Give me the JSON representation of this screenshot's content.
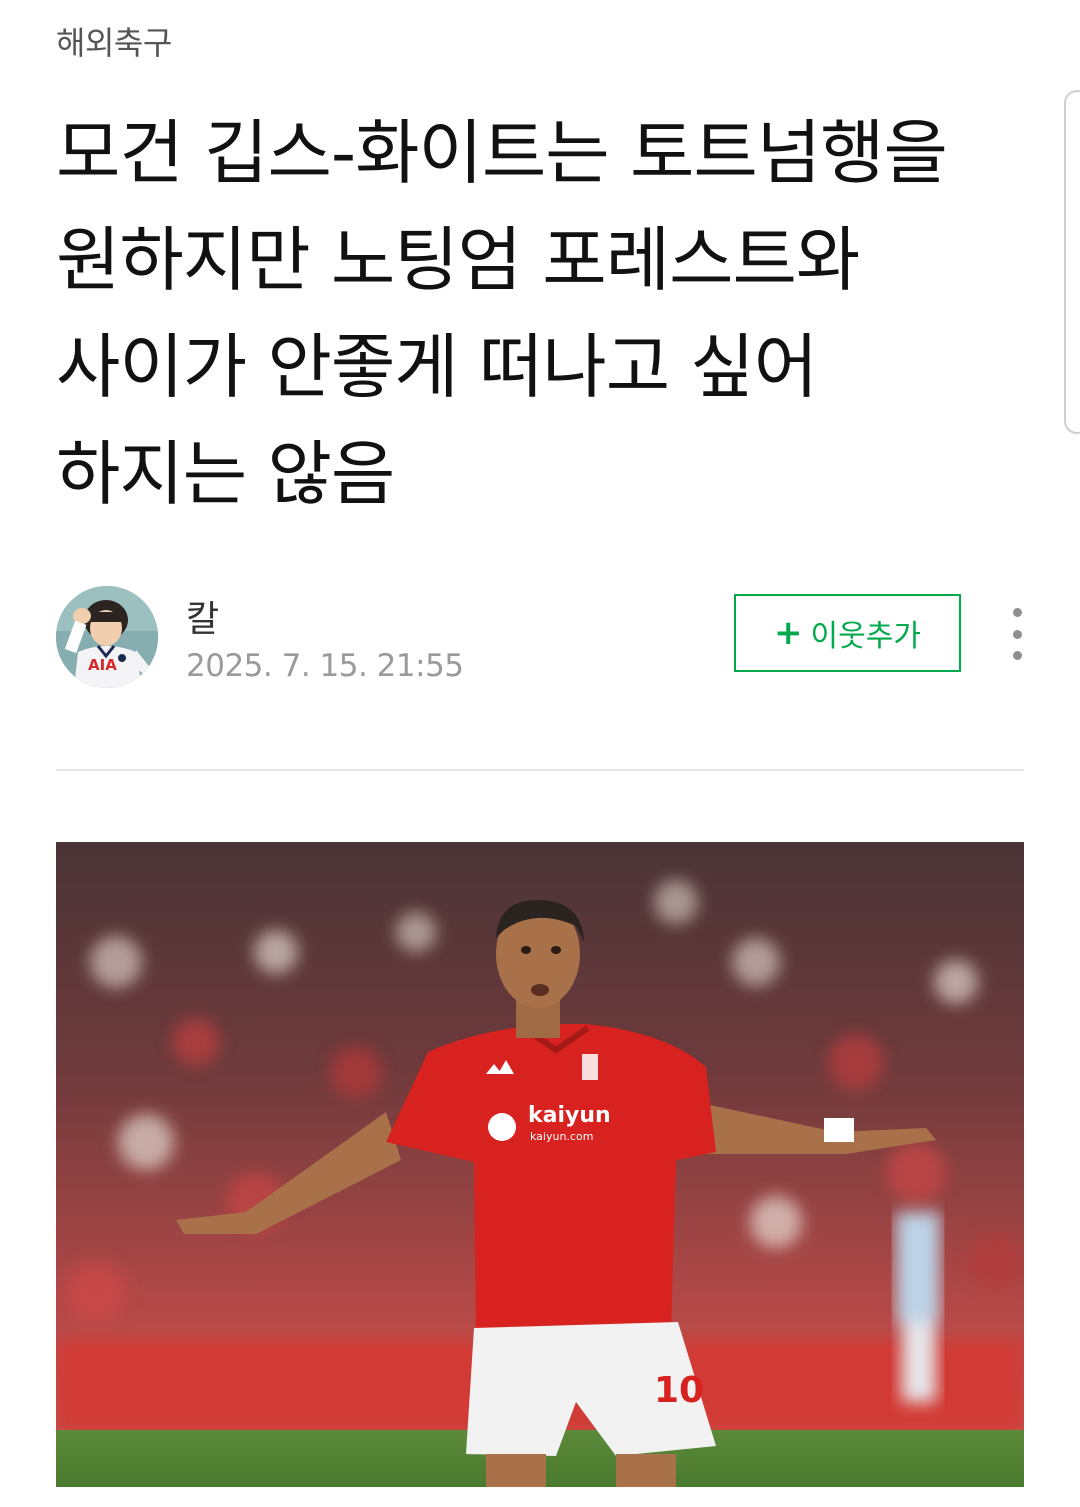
{
  "header": {
    "category": "해외축구"
  },
  "article": {
    "title": "모건 깁스-화이트는 토트넘행을 원하지만 노팅엄 포레스트와 사이가 안좋게 떠나고 싶어 하지는 않음"
  },
  "author": {
    "name": "칼",
    "date": "2025. 7. 15. 21:55",
    "avatar_text": "AIA"
  },
  "actions": {
    "follow_plus": "+",
    "follow_label": "이웃추가",
    "more_icon": "more-vertical-icon"
  },
  "photo": {
    "sponsor_main": "kaiyun",
    "sponsor_sub": "kaiyun.com",
    "shirt_number": "10"
  },
  "colors": {
    "accent_green": "#03a94d",
    "kit_red": "#d8221f"
  }
}
